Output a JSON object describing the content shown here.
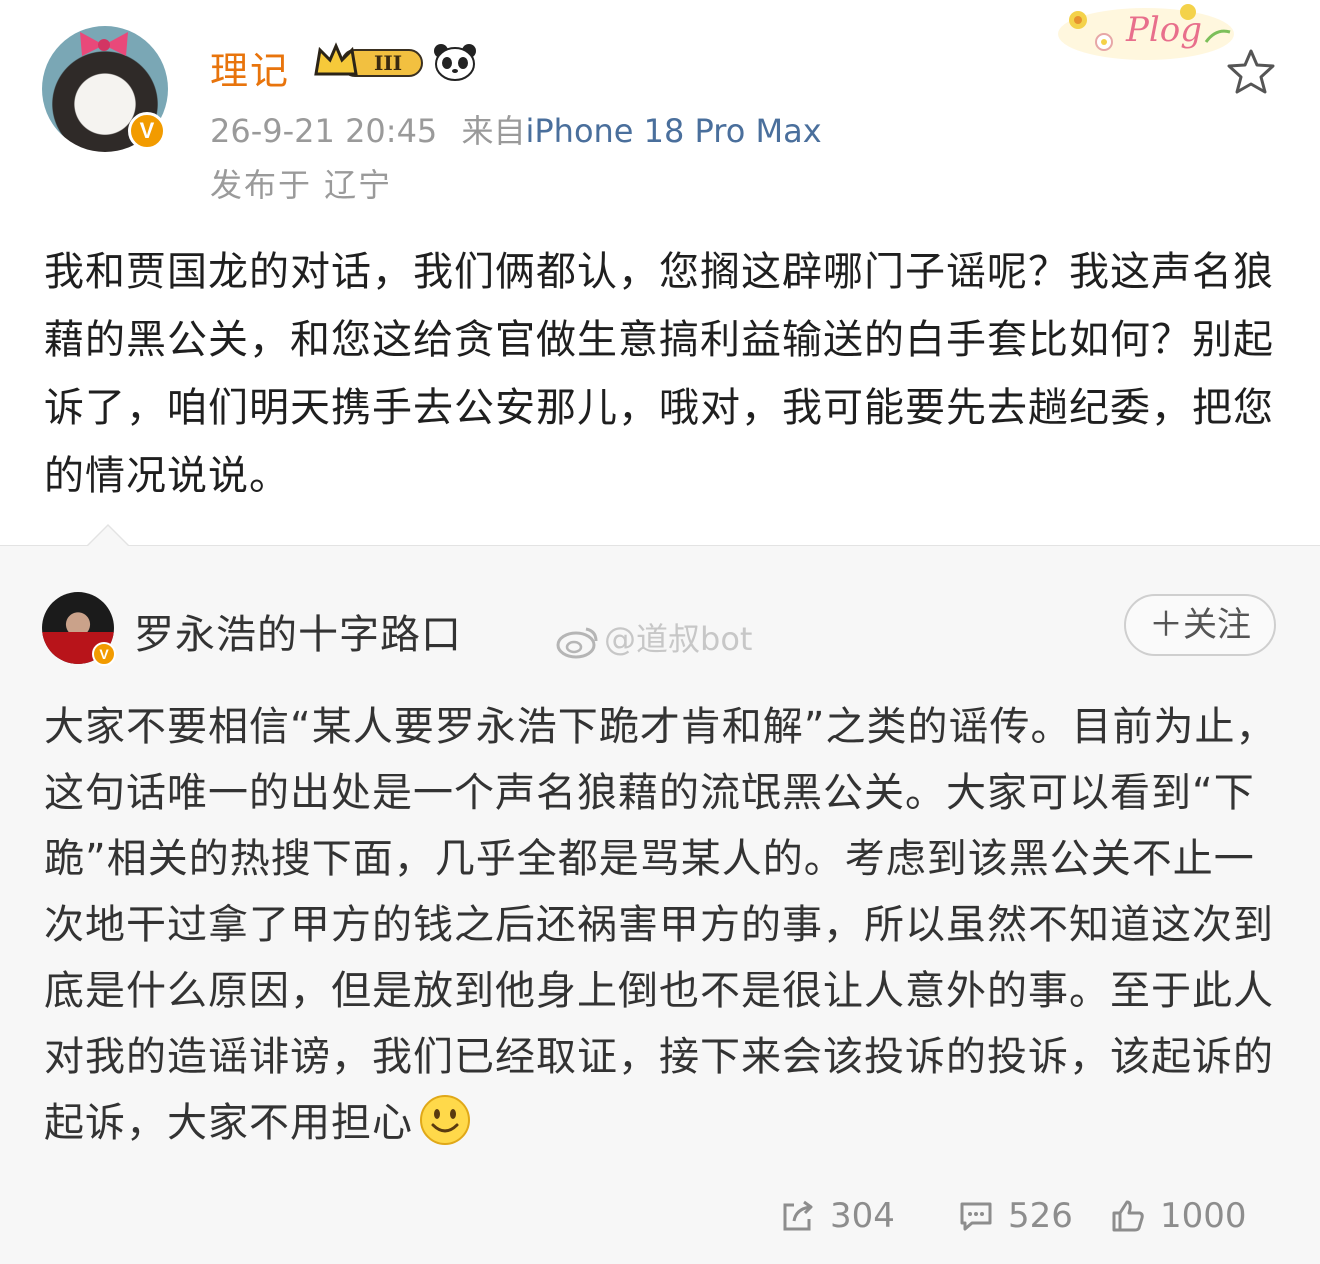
{
  "post": {
    "username": "理记",
    "level_badge": "III",
    "timestamp": "26-9-21 20:45",
    "source_prefix": "来自",
    "device": "iPhone 18 Pro Max",
    "location": "发布于 辽宁",
    "sticker_text": "Plog",
    "text": "我和贾国龙的对话，我们俩都认，您搁这辟哪门子谣呢？我这声名狼藉的黑公关，和您这给贪官做生意搞利益输送的白手套比如何？别起诉了，咱们明天携手去公安那儿，哦对，我可能要先去趟纪委，把您的情况说说。"
  },
  "repost": {
    "author": "罗永浩的十字路口",
    "follow_label": "＋关注",
    "watermark": "@道叔bot",
    "text": "大家不要相信“某人要罗永浩下跪才肯和解”之类的谣传。目前为止，这句话唯一的出处是一个声名狼藉的流氓黑公关。大家可以看到“下跪”相关的热搜下面，几乎全都是骂某人的。考虑到该黑公关不止一次地干过拿了甲方的钱之后还祸害甲方的事，所以虽然不知道这次到底是什么原因，但是放到他身上倒也不是很让人意外的事。至于此人对我的造谣诽谤，我们已经取证，接下来会该投诉的投诉，该起诉的起诉，大家不用担心"
  },
  "actions": {
    "share_count": "304",
    "comment_count": "526",
    "like_count": "1000"
  },
  "colors": {
    "username": "#e8740c",
    "device_link": "#4a6f9c",
    "verified_badge": "#f29b00",
    "meta_gray": "#9a9a9a",
    "repost_bg": "#f7f7f7"
  }
}
